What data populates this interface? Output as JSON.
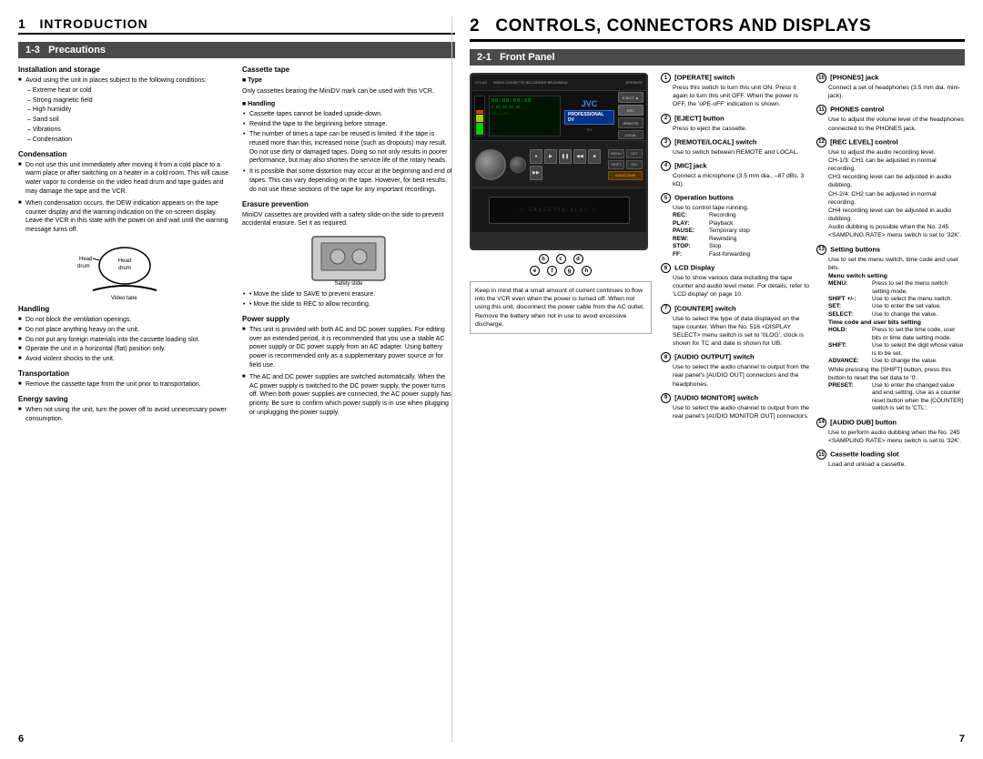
{
  "left": {
    "chapter_num": "1",
    "chapter_title": "INTRODUCTION",
    "section_num": "1-3",
    "section_title": "Precautions",
    "installation": {
      "title": "Installation and storage",
      "bullet1": "Avoid using the unit in places subject to the following conditions:",
      "conditions": [
        "– Extreme heat or cold",
        "– Strong magnetic field",
        "– High humidity",
        "– Sand soil",
        "– Vibrations",
        "– Condensation"
      ]
    },
    "condensation": {
      "title": "Condensation",
      "para1": "Do not use this unit immediately after moving it from a cold place to a warm place or after switching on a heater in a cold room. This will cause water vapor to condense on the video head drum and tape guides and may damage the tape and the VCR.",
      "para2": "When condensation occurs, the DEW indication appears on the tape counter display and the warning indication on the on-screen display. Leave the VCR in this state with the power on and wait until the warning message turns off.",
      "diagram_label1": "Head drum",
      "diagram_label2": "Video tape"
    },
    "handling": {
      "title": "Handling",
      "bullets": [
        "Do not block the ventilation openings.",
        "Do not place anything heavy on the unit.",
        "Do not put any foreign materials into the cassette loading slot.",
        "Operate the unit in a horizontal (flat) position only.",
        "Avoid violent shocks to the unit."
      ]
    },
    "transport": {
      "title": "Transportation",
      "bullet": "Remove the cassette tape from the unit prior to transportation."
    },
    "energy": {
      "title": "Energy saving",
      "bullet": "When not using the unit, turn the power off to avoid unnecessary power consumption."
    },
    "cassette_tape": {
      "title": "Cassette tape",
      "type_title": "■ Type",
      "type_text": "Only cassettes bearing the MiniDV mark can be used with this VCR.",
      "handling_title": "■ Handling",
      "handling_bullets": [
        "Cassette tapes cannot be loaded upside-down.",
        "Rewind the tape to the beginning before storage.",
        "The number of times a tape can be reused is limited. If the tape is reused more than this, increased noise (such as dropouts) may result. Do not use dirty or damaged tapes. Doing so not only results in poorer performance, but may also shorten the service life of the rotary heads.",
        "It is possible that some distortion may occur at the beginning and end of tapes. This can vary depending on the tape. However, for best results, do not use these sections of the tape for any important recordings."
      ]
    },
    "erasure": {
      "title": "Erasure prevention",
      "text": "MiniDV cassettes are provided with a safety slide on the side to prevent accidental erasure. Set it as required.",
      "note1": "• Move the slide to SAVE to prevent erasure.",
      "note2": "• Move the slide to REC to allow recording.",
      "diagram_label": "Safety slide"
    },
    "power_supply": {
      "title": "Power supply",
      "bullets": [
        "This unit is provided with both AC and DC power supplies. For editing over an extended period, it is recommended that you use a stable AC power supply or DC power supply from an AC adapter. Using battery power is recommended only as a supplementary power source or for field use.",
        "The AC and DC power supplies are switched automatically. When the AC power supply is switched to the DC power supply, the power turns off. When both power supplies are connected, the AC power supply has priority. Be sure to confirm which power supply is in use when plugging or unplugging the power supply."
      ]
    },
    "page_number": "6"
  },
  "right": {
    "chapter_num": "2",
    "chapter_title": "CONTROLS, CONNECTORS AND DISPLAYS",
    "section_num": "2-1",
    "section_title": "Front Panel",
    "note_box": "Keep in mind that a small amount of current continues to flow into the VCR even when the power is turned off. When not using this unit, disconnect the power cable from the AC outlet. Remove the battery when not in use to avoid excessive discharge.",
    "items": [
      {
        "num": "1",
        "title": "[OPERATE] switch",
        "body": "Press this switch to turn this unit ON. Press it again to turn this unit OFF. When the power is OFF, the 'oPE-oFF' indication is shown."
      },
      {
        "num": "2",
        "title": "[EJECT] button",
        "body": "Press to eject the cassette."
      },
      {
        "num": "3",
        "title": "[REMOTE/LOCAL] switch",
        "body": "Use to switch between REMOTE and LOCAL."
      },
      {
        "num": "4",
        "title": "[MIC] jack",
        "body": "Connect a microphone (3.5 mm dia., –87 dBs, 3 kΩ)."
      },
      {
        "num": "5",
        "title": "Operation buttons",
        "body": "Use to control tape running.",
        "ops": [
          {
            "label": "REC:",
            "value": "Recording"
          },
          {
            "label": "PLAY:",
            "value": "Playback"
          },
          {
            "label": "PAUSE:",
            "value": "Temporary stop"
          },
          {
            "label": "REW:",
            "value": "Rewinding"
          },
          {
            "label": "STOP:",
            "value": "Stop"
          },
          {
            "label": "FF:",
            "value": "Fast-forwarding"
          }
        ]
      },
      {
        "num": "6",
        "title": "LCD Display",
        "body": "Use to show various data including the tape counter and audio level meter. For details, refer to 'LCD display' on page 10."
      },
      {
        "num": "7",
        "title": "[COUNTER] switch",
        "body": "Use to select the type of data displayed on the tape counter. When the No. 516 <DISPLAY SELECT> menu switch is set to '0LOG', clock is shown for TC and date is shown for UB."
      },
      {
        "num": "8",
        "title": "[AUDIO OUTPUT] switch",
        "body": "Use to select the audio channel to output from the rear panel's [AUDIO OUT] connectors and the headphones."
      },
      {
        "num": "9",
        "title": "[AUDIO MONITOR] switch",
        "body": "Use to select the audio channel to output from the rear panel's [AUDIO MONITOR OUT] connectors."
      },
      {
        "num": "10",
        "title": "[PHONES] jack",
        "body": "Connect a set of headphones (3.5 mm dia. mini-jack)."
      },
      {
        "num": "11",
        "title": "PHONES control",
        "body": "Use to adjust the volume level of the headphones connected to the PHONES jack."
      },
      {
        "num": "12",
        "title": "[REC LEVEL] control",
        "body": "Use to adjust the audio recording level.\nCH-1/3: CH1 can be adjusted in normal recording. CH3 recording level can be adjusted in audio dubbing.\nCH-2/4: CH2 can be adjusted in normal recording. CH4 recording level can be adjusted in audio dubbing.\nAudio dubbing is possible when the No. 245 <SAMPLING RATE> menu switch is set to '32K'."
      },
      {
        "num": "13",
        "title": "Setting buttons",
        "body": "Use to set the menu switch, time code and user bits.",
        "settings": [
          {
            "label": "Menu switch setting"
          },
          {
            "label": "MENU:   Press to set the menu switch setting mode."
          },
          {
            "label": "SHIFT +/-:  Use to select the menu switch."
          },
          {
            "label": "SET:    Use to enter the set value."
          },
          {
            "label": "SELECT: Use to change the value."
          },
          {
            "label": "Time code and user bits setting"
          },
          {
            "label": "HOLD:   Press to set the time code, user bits or time date setting mode."
          },
          {
            "label": "SHIFT:  Use to select the digit whose value is to be set."
          },
          {
            "label": "ADVANCE: Use to change the value."
          },
          {
            "label": "While pressing the [SHIFT] button, press this button to reset the set data to '0'."
          },
          {
            "label": "PRESET: Use to enter the changed value and end setting. Use as a counter reset button when the [COUNTER] switch is set to 'CTL'."
          }
        ]
      },
      {
        "num": "14",
        "title": "[AUDIO DUB] button",
        "body": "Use to perform audio dubbing when the No. 245 <SAMPLING RATE> menu switch is set to '32K'."
      },
      {
        "num": "15",
        "title": "Cassette loading slot",
        "body": "Load and unload a cassette."
      }
    ],
    "page_number": "7"
  }
}
